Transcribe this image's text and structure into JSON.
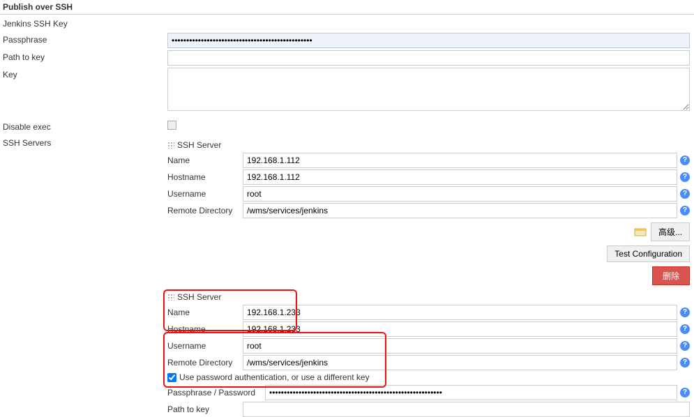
{
  "section_title": "Publish over SSH",
  "left": {
    "jenkins_ssh_key": "Jenkins SSH Key",
    "passphrase": "Passphrase",
    "path_to_key": "Path to key",
    "key": "Key",
    "disable_exec": "Disable exec",
    "ssh_servers": "SSH Servers"
  },
  "passphrase_value": "••••••••••••••••••••••••••••••••••••••••••••••••",
  "server1": {
    "header": "SSH Server",
    "name_label": "Name",
    "name_value": "192.168.1.112",
    "host_label": "Hostname",
    "host_value": "192.168.1.112",
    "user_label": "Username",
    "user_value": "root",
    "rdir_label": "Remote Directory",
    "rdir_value": "/wms/services/jenkins"
  },
  "buttons": {
    "advanced": "高级...",
    "test_config": "Test Configuration",
    "delete": "删除"
  },
  "server2": {
    "header": "SSH Server",
    "name_label": "Name",
    "name_value": "192.168.1.233",
    "host_label": "Hostname",
    "host_value": "192.168.1.233",
    "user_label": "Username",
    "user_value": "root",
    "rdir_label": "Remote Directory",
    "rdir_value": "/wms/services/jenkins",
    "use_pw_label": "Use password authentication, or use a different key",
    "pass_label": "Passphrase / Password",
    "pass_value": "•••••••••••••••••••••••••••••••••••••••••••••••••••••••••••",
    "path_label": "Path to key"
  }
}
